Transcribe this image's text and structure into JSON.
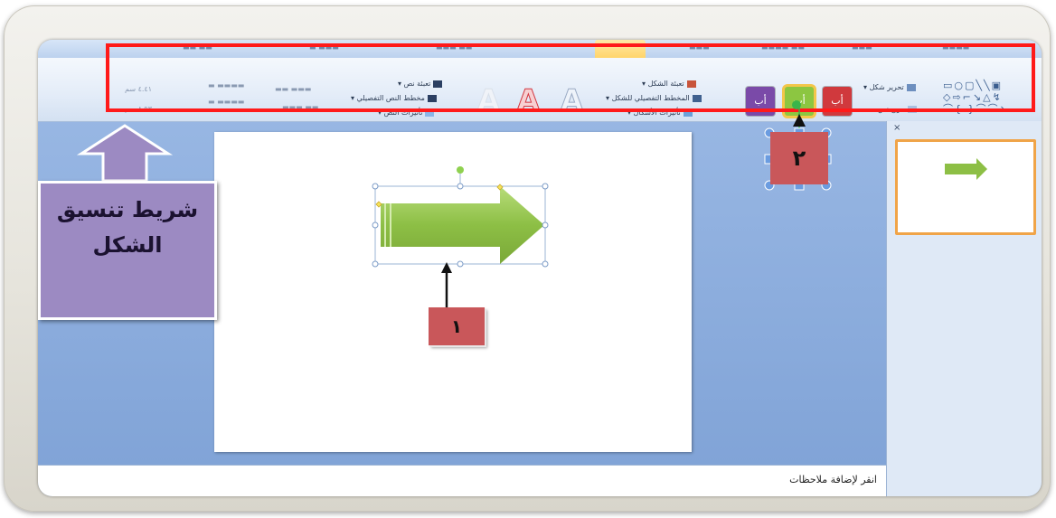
{
  "colors": {
    "red_outline": "#ff1a1a",
    "ribbon_bg": "#e3ecf8",
    "app_bg": "#7fa2d6",
    "callout_purple": "#9c8ac2",
    "callout_red": "#c9575a",
    "arrow_green": "#8dbf45",
    "thumb_border": "#f0a448",
    "style_red": "#d0393d",
    "style_green": "#8cc641",
    "style_purple": "#7a4aa8"
  },
  "callouts": {
    "ribbon_caption": "شريط تنسيق الشكل",
    "label_one": "١",
    "label_two": "٢"
  },
  "ribbon": {
    "edit_shape": "تحرير شكل",
    "text_box": "مربع نص",
    "shape_fill": "تعبئة الشكل",
    "shape_outline": "المخطط التفصيلي للشكل",
    "shape_effects": "تأثيرات الأشكال",
    "text_fill": "تعبئة نص",
    "text_outline": "مخطط النص التفصيلي",
    "text_effects": "تأثيرات النص",
    "style_button_text": "أب",
    "wordart_glyph": "A",
    "size_height": "٤.٤١ سم",
    "size_width": "٨.٩٣ سم"
  },
  "panel": {
    "close_symbol": "×"
  },
  "notes": {
    "placeholder": "انقر لإضافة ملاحظات"
  }
}
